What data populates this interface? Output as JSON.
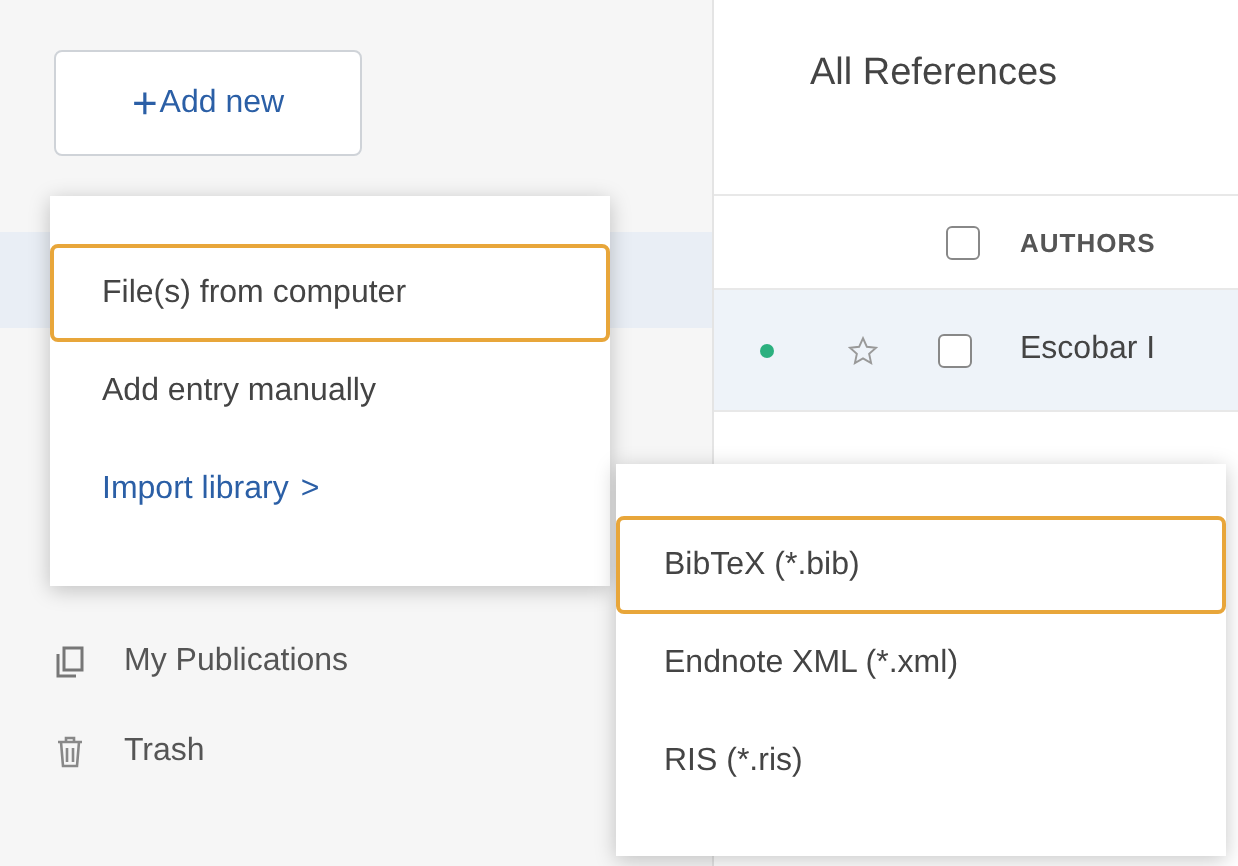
{
  "sidebar": {
    "add_button": {
      "icon": "+",
      "label": "Add new"
    },
    "items": [
      {
        "label": "My Publications",
        "kind": "publications",
        "selected": false
      },
      {
        "label": "Trash",
        "kind": "trash",
        "selected": false
      }
    ]
  },
  "main": {
    "title": "All References",
    "table": {
      "columns": [
        {
          "label": "AUTHORS"
        }
      ],
      "select_all_checked": false,
      "rows": [
        {
          "color": "#2bb07f",
          "starred": false,
          "checked": false,
          "selected": true,
          "authors": "Escobar I"
        }
      ]
    }
  },
  "add_menu": {
    "items": [
      {
        "label": "File(s) from computer",
        "kind": "action",
        "selected": true
      },
      {
        "label": "Add entry manually",
        "kind": "action",
        "selected": false
      },
      {
        "label": "Import library",
        "kind": "submenu",
        "submenu_icon": ">",
        "selected": false
      }
    ]
  },
  "import_submenu": {
    "items": [
      {
        "label": "BibTeX (*.bib)",
        "selected": true
      },
      {
        "label": "Endnote XML (*.xml)",
        "selected": false
      },
      {
        "label": "RIS (*.ris)",
        "selected": false
      }
    ]
  }
}
